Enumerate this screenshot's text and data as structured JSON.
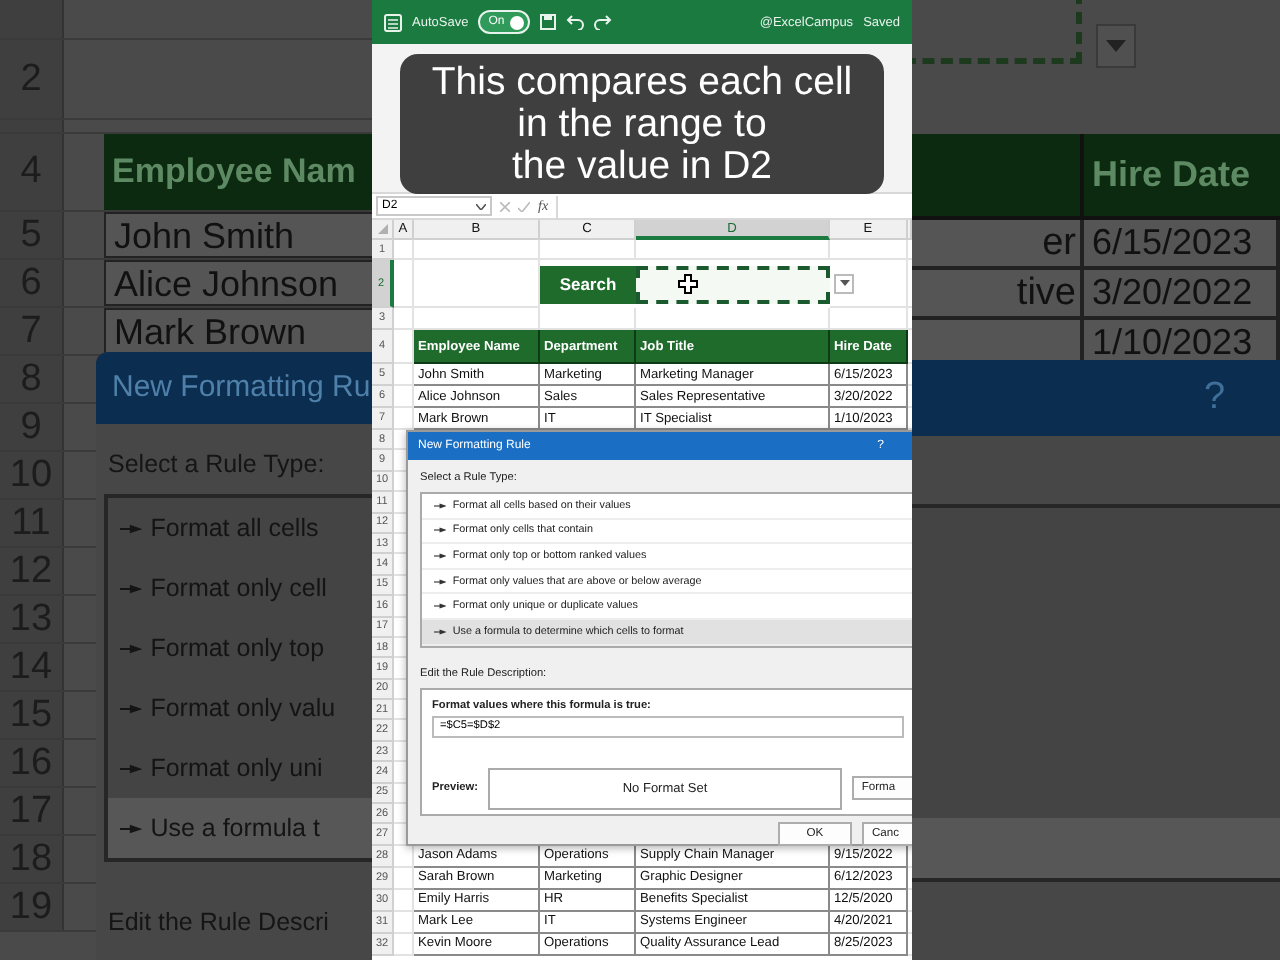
{
  "background_left": {
    "row_numbers": [
      "2",
      "4",
      "5",
      "6",
      "7",
      "8",
      "9",
      "10",
      "11",
      "12",
      "13",
      "14",
      "15",
      "16",
      "17",
      "18",
      "19"
    ],
    "table_header": "Employee Nam",
    "names": [
      "John Smith",
      "Alice Johnson",
      "Mark Brown"
    ],
    "dialog": {
      "title": "New Formatting Ru",
      "rule_type_label": "Select a Rule Type:",
      "rule_types": [
        {
          "label": "Format all cells",
          "selected": false
        },
        {
          "label": "Format only cell",
          "selected": false
        },
        {
          "label": "Format only top",
          "selected": false
        },
        {
          "label": "Format only valu",
          "selected": false
        },
        {
          "label": "Format only uni",
          "selected": false
        },
        {
          "label": "Use a formula t",
          "selected": true
        }
      ],
      "description_label": "Edit the Rule Descri"
    }
  },
  "excel": {
    "title_bar": {
      "autosave_label": "AutoSave",
      "autosave_toggle": {
        "label": "On",
        "on": true
      },
      "account": "@ExcelCampus",
      "status": "Saved"
    },
    "formula_bar": {
      "name_box": "D2",
      "function_label": "fx"
    },
    "column_headers": [
      {
        "label": "A",
        "selected": false
      },
      {
        "label": "B",
        "selected": false
      },
      {
        "label": "C",
        "selected": false
      },
      {
        "label": "D",
        "selected": true
      },
      {
        "label": "E",
        "selected": false
      }
    ],
    "row_numbers": [
      {
        "label": "1",
        "selected": false
      },
      {
        "label": "2",
        "selected": true
      },
      {
        "label": "3",
        "selected": false
      },
      {
        "label": "4",
        "selected": false
      },
      {
        "label": "5",
        "selected": false
      },
      {
        "label": "6",
        "selected": false
      },
      {
        "label": "7",
        "selected": false
      },
      {
        "label": "8",
        "selected": false
      },
      {
        "label": "9",
        "selected": false
      },
      {
        "label": "10",
        "selected": false
      },
      {
        "label": "11",
        "selected": false
      },
      {
        "label": "12",
        "selected": false
      },
      {
        "label": "13",
        "selected": false
      },
      {
        "label": "14",
        "selected": false
      },
      {
        "label": "15",
        "selected": false
      },
      {
        "label": "16",
        "selected": false
      },
      {
        "label": "17",
        "selected": false
      },
      {
        "label": "18",
        "selected": false
      },
      {
        "label": "19",
        "selected": false
      },
      {
        "label": "20",
        "selected": false
      },
      {
        "label": "21",
        "selected": false
      },
      {
        "label": "22",
        "selected": false
      },
      {
        "label": "23",
        "selected": false
      },
      {
        "label": "24",
        "selected": false
      },
      {
        "label": "25",
        "selected": false
      },
      {
        "label": "26",
        "selected": false
      },
      {
        "label": "27",
        "selected": false
      },
      {
        "label": "28",
        "selected": false
      },
      {
        "label": "29",
        "selected": false
      },
      {
        "label": "30",
        "selected": false
      },
      {
        "label": "31",
        "selected": false
      },
      {
        "label": "32",
        "selected": false
      }
    ],
    "search_button": "Search",
    "table": {
      "columns": [
        "Employee Name",
        "Department",
        "Job Title",
        "Hire Date"
      ],
      "rows_top": [
        [
          "John Smith",
          "Marketing",
          "Marketing Manager",
          "6/15/2023"
        ],
        [
          "Alice Johnson",
          "Sales",
          "Sales Representative",
          "3/20/2022"
        ],
        [
          "Mark Brown",
          "IT",
          "IT Specialist",
          "1/10/2023"
        ]
      ],
      "rows_bottom": [
        [
          "Jason Adams",
          "Operations",
          "Supply Chain Manager",
          "9/15/2022"
        ],
        [
          "Sarah Brown",
          "Marketing",
          "Graphic Designer",
          "6/12/2023"
        ],
        [
          "Emily Harris",
          "HR",
          "Benefits Specialist",
          "12/5/2020"
        ],
        [
          "Mark Lee",
          "IT",
          "Systems Engineer",
          "4/20/2021"
        ],
        [
          "Kevin Moore",
          "Operations",
          "Quality Assurance Lead",
          "8/25/2023"
        ]
      ]
    },
    "dialog": {
      "title": "New Formatting Rule",
      "help": "?",
      "rule_type_label": "Select a Rule Type:",
      "rule_types": [
        {
          "label": "Format all cells based on their values",
          "selected": false
        },
        {
          "label": "Format only cells that contain",
          "selected": false
        },
        {
          "label": "Format only top or bottom ranked values",
          "selected": false
        },
        {
          "label": "Format only values that are above or below average",
          "selected": false
        },
        {
          "label": "Format only unique or duplicate values",
          "selected": false
        },
        {
          "label": "Use a formula to determine which cells to format",
          "selected": true
        }
      ],
      "description_label": "Edit the Rule Description:",
      "formula_label": "Format values where this formula is true:",
      "formula": "=$C5=$D$2",
      "preview_label": "Preview:",
      "preview": "No Format Set",
      "format_button": "Forma",
      "ok_button": "OK",
      "cancel_button": "Canc"
    }
  },
  "caption": {
    "lines": [
      "This compares each cell",
      "in the range to",
      "the value in D2"
    ]
  },
  "background_right": {
    "table_header": "Hire Date",
    "rows": [
      {
        "job_title": "er",
        "hire_date": "6/15/2023"
      },
      {
        "job_title": "tive",
        "hire_date": "3/20/2022"
      },
      {
        "hire_date": "1/10/2023"
      }
    ],
    "dialog": {
      "help": "?"
    }
  }
}
